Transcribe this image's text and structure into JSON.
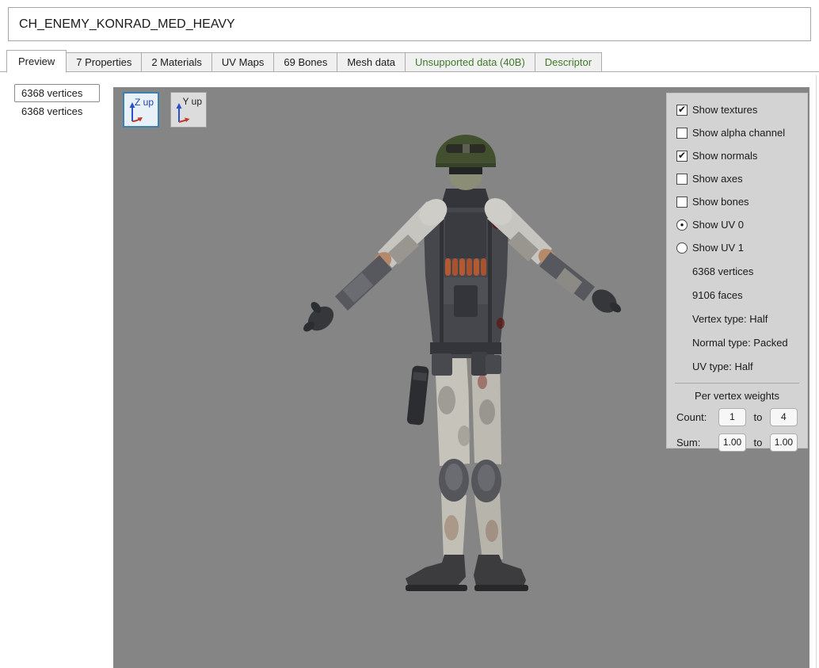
{
  "header": {
    "model_name": "CH_ENEMY_KONRAD_MED_HEAVY"
  },
  "tabs": [
    {
      "label": "Preview",
      "active": true
    },
    {
      "label": "7 Properties"
    },
    {
      "label": "2 Materials"
    },
    {
      "label": "UV Maps"
    },
    {
      "label": "69 Bones"
    },
    {
      "label": "Mesh data"
    },
    {
      "label": "Unsupported data (40B)",
      "green": true
    },
    {
      "label": "Descriptor",
      "green": true
    }
  ],
  "lod_list": [
    "6368 vertices",
    "6368 vertices"
  ],
  "viewport": {
    "z_up_label": "Z up",
    "y_up_label": "Y up"
  },
  "options": {
    "checkboxes": [
      {
        "label": "Show textures",
        "checked": true,
        "mark": "✔"
      },
      {
        "label": "Show alpha channel",
        "checked": false,
        "mark": ""
      },
      {
        "label": "Show normals",
        "checked": true,
        "mark": "✔"
      },
      {
        "label": "Show axes",
        "checked": false,
        "mark": ""
      },
      {
        "label": "Show bones",
        "checked": false,
        "mark": ""
      }
    ],
    "radios": [
      {
        "label": "Show UV 0",
        "selected": true,
        "mark": "●"
      },
      {
        "label": "Show UV 1",
        "selected": false,
        "mark": ""
      }
    ],
    "stats": [
      "6368 vertices",
      "9106 faces",
      "Vertex type: Half",
      "Normal type: Packed",
      "UV type: Half"
    ],
    "weights": {
      "title": "Per vertex weights",
      "count_label": "Count:",
      "count_min": "1",
      "count_max": "4",
      "to": "to",
      "sum_label": "Sum:",
      "sum_min": "1.00",
      "sum_max": "1.00"
    }
  },
  "colors": {
    "viewport_bg": "#858585",
    "panel_bg": "#d3d3d3",
    "selected_button_border": "#3c7fb1",
    "green_tab_text": "#3e7b27"
  }
}
